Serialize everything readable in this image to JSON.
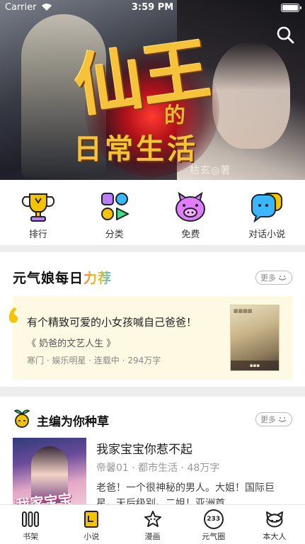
{
  "status_bar": {
    "carrier": "Carrier",
    "time": "3:59 PM"
  },
  "banner": {
    "title_main": "仙王",
    "title_de": "的",
    "title_sub": "日常生活",
    "author": "枯玄◎著"
  },
  "categories": [
    {
      "label": "排行",
      "icon": "trophy-icon"
    },
    {
      "label": "分类",
      "icon": "category-grid-icon"
    },
    {
      "label": "免费",
      "icon": "free-pig-icon"
    },
    {
      "label": "对话小说",
      "icon": "chat-bubbles-icon"
    }
  ],
  "recommend": {
    "title_prefix": "元气娘每日",
    "title_accent": "力荐",
    "more_label": "更多",
    "card": {
      "headline": "有个精致可爱的小女孩喊自己爸爸！",
      "book_name": "《 奶爸的文艺人生 》",
      "meta": "寒门 · 娱乐明星 · 连载中 · 294万字"
    }
  },
  "editor_picks": {
    "title": "主编为你种草",
    "more_label": "更多",
    "book": {
      "title": "我家宝宝你惹不起",
      "meta": "帝馨01 · 都市生活 · 48万字",
      "description": "老爸！一个很神秘的男人。大姐！国际巨星，天后级别。二姐！亚洲首",
      "cover_text": "我家宝宝"
    }
  },
  "tabs": [
    {
      "label": "书架",
      "icon": "bookshelf-icon"
    },
    {
      "label": "小说",
      "icon": "novel-book-icon"
    },
    {
      "label": "漫画",
      "icon": "comic-star-icon"
    },
    {
      "label": "元气圈",
      "icon": "community-233-icon",
      "badge": "233"
    },
    {
      "label": "本大人",
      "icon": "profile-face-icon"
    }
  ],
  "colors": {
    "accent_yellow": "#f5c400",
    "badge_bg": "#fdf9e3"
  }
}
